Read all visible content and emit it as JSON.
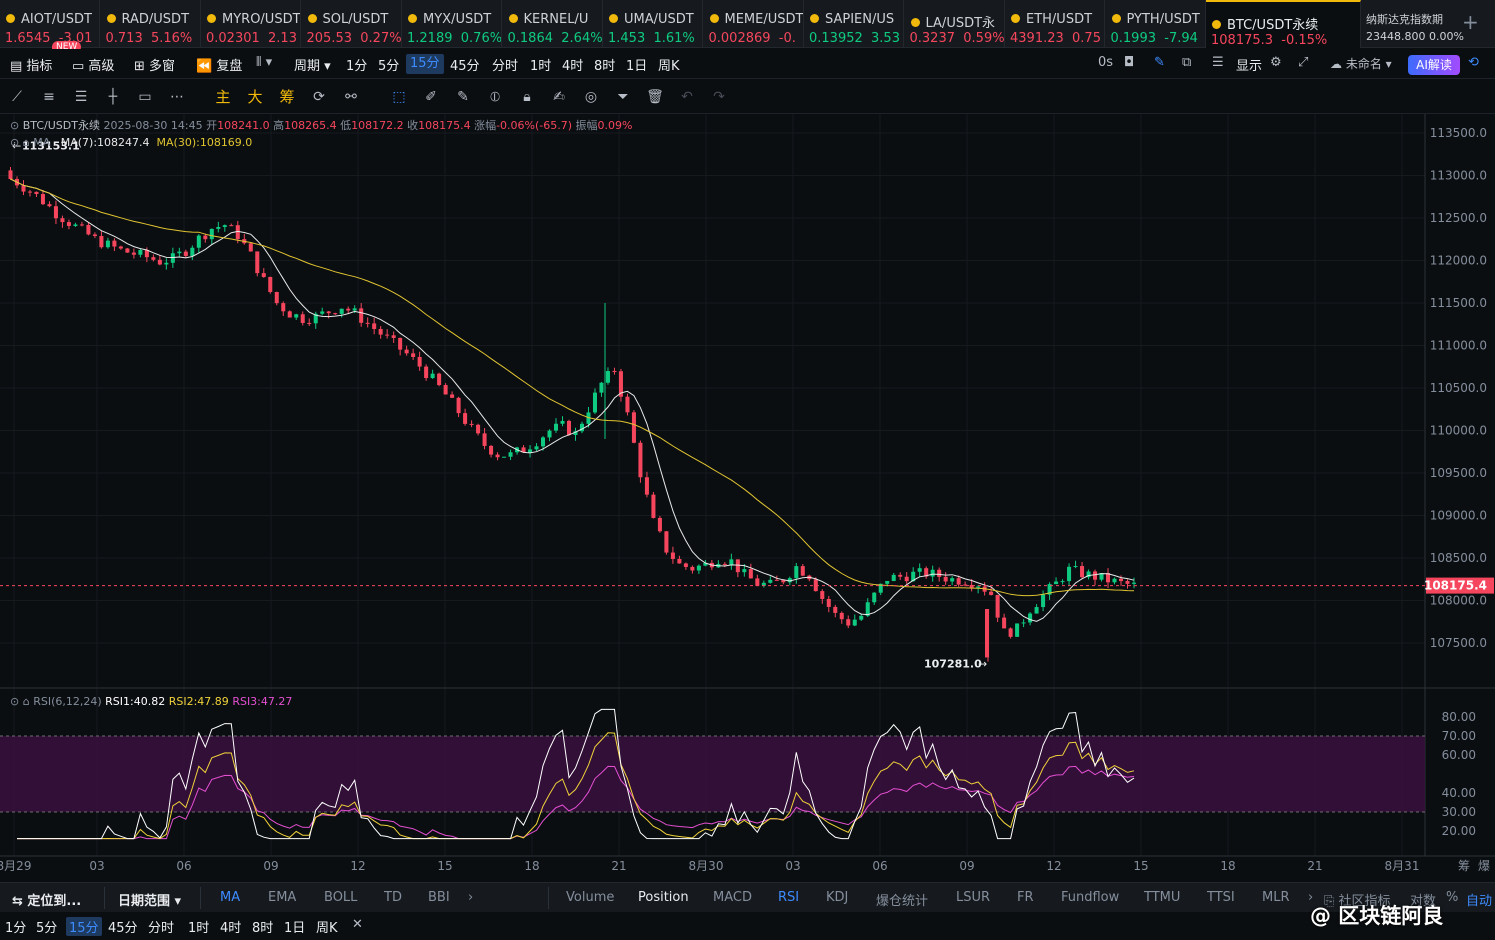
{
  "tickers": [
    {
      "symbol": "AIOT/USDT",
      "price": "1.6545",
      "change": "-3.01",
      "up": false
    },
    {
      "symbol": "RAD/USDT",
      "price": "0.713",
      "change": "5.16%",
      "up": false
    },
    {
      "symbol": "MYRO/USDT",
      "price": "0.02301",
      "change": "2.13",
      "up": false
    },
    {
      "symbol": "SOL/USDT",
      "price": "205.53",
      "change": "0.27%",
      "up": false
    },
    {
      "symbol": "MYX/USDT",
      "price": "1.2189",
      "change": "0.76%",
      "up": true
    },
    {
      "symbol": "KERNEL/U",
      "price": "0.1864",
      "change": "2.64%",
      "up": true
    },
    {
      "symbol": "UMA/USDT",
      "price": "1.453",
      "change": "1.61%",
      "up": true
    },
    {
      "symbol": "MEME/USDT",
      "price": "0.002869",
      "change": "-0.",
      "up": false
    },
    {
      "symbol": "SAPIEN/US",
      "price": "0.13952",
      "change": "3.53",
      "up": true
    },
    {
      "symbol": "LA/USDT永",
      "price": "0.3237",
      "change": "0.59%",
      "up": false
    },
    {
      "symbol": "ETH/USDT",
      "price": "4391.23",
      "change": "0.75",
      "up": false
    },
    {
      "symbol": "PYTH/USDT",
      "price": "0.1993",
      "change": "-7.94",
      "up": true
    },
    {
      "symbol": "BTC/USDT永续",
      "price": "108175.3",
      "change": "-0.15%",
      "up": false,
      "active": true
    }
  ],
  "new_badge": "NEW",
  "nasdaq": {
    "title": "纳斯达克指数期",
    "value": "23448.800",
    "change": "0.00%"
  },
  "toolbar": {
    "indicator": "指标",
    "advanced": "高级",
    "multi_window": "多窗",
    "replay": "复盘",
    "period": "周期",
    "intervals": [
      "1分",
      "5分",
      "15分",
      "45分",
      "分时",
      "1时",
      "4时",
      "8时",
      "1日",
      "周K"
    ],
    "selected_interval": "15分",
    "countdown": "0s",
    "display": "显示",
    "unnamed": "未命名",
    "ai": "AI解读"
  },
  "tools_gold": [
    "主",
    "大",
    "筹"
  ],
  "info": {
    "pair": "BTC/USDT永续",
    "datetime": "2025-08-30 14:45",
    "open_label": "开",
    "open": "108241.0",
    "high_label": "高",
    "high": "108265.4",
    "low_label": "低",
    "low": "108172.2",
    "close_label": "收",
    "close": "108175.4",
    "change_label": "涨幅",
    "change": "-0.06%(-65.7)",
    "amp_label": "振幅",
    "amp": "0.09%"
  },
  "ma_legend": {
    "label": "MA",
    "ma7": "MA(7):108247.4",
    "ma30": "MA(30):108169.0"
  },
  "rsi_legend": {
    "label": "RSI(6,12,24)",
    "rsi1": "RSI1:40.82",
    "rsi2": "RSI2:47.89",
    "rsi3": "RSI3:47.27"
  },
  "colors": {
    "up": "#0ecb81",
    "down": "#f6465d",
    "ma7": "#e8e8e8",
    "ma30": "#e0c431",
    "rsi1": "#ffffff",
    "rsi2": "#f0d23a",
    "rsi3": "#e34fd1",
    "rsi_band": "#3a0f3e"
  },
  "chart_data": {
    "type": "candlestick",
    "symbol": "BTC/USDT永续",
    "interval": "15分",
    "price_axis": [
      "113500.0",
      "113000.0",
      "112500.0",
      "112000.0",
      "111500.0",
      "111000.0",
      "110500.0",
      "110000.0",
      "109500.0",
      "109000.0",
      "108500.0",
      "108000.0",
      "107500.0"
    ],
    "ylim": [
      107000,
      113800
    ],
    "current_price": "108175.4",
    "high_marker": "113153.1",
    "low_marker": "107281.0",
    "x_labels": [
      "8月29",
      "03",
      "06",
      "09",
      "12",
      "15",
      "18",
      "21",
      "8月30",
      "03",
      "06",
      "09",
      "12",
      "15",
      "18",
      "21",
      "8月31"
    ],
    "rsi_axis": [
      "80.00",
      "70.00",
      "60.00",
      "40.00",
      "30.00",
      "20.00"
    ],
    "rsi_band": [
      30,
      70
    ],
    "rsi_ylim": [
      15,
      85
    ],
    "close_series": [
      113000,
      112920,
      112820,
      112700,
      112560,
      112450,
      112350,
      112250,
      112180,
      112120,
      112080,
      112040,
      111990,
      112020,
      112120,
      112260,
      112380,
      112420,
      112300,
      112060,
      111760,
      111500,
      111380,
      111320,
      111340,
      111400,
      111460,
      111380,
      111260,
      111140,
      111020,
      110900,
      110760,
      110600,
      110420,
      110220,
      110010,
      109830,
      109720,
      109710,
      109780,
      109880,
      110000,
      110050,
      109960,
      110260,
      110550,
      110720,
      110180,
      109500,
      108920,
      108600,
      108420,
      108380,
      108420,
      108500,
      108460,
      108300,
      108200,
      108180,
      108250,
      108400,
      108300,
      108030,
      107830,
      107740,
      107820,
      108060,
      108260,
      108280,
      108310,
      108320,
      108290,
      108250,
      108240,
      108200,
      108080,
      107620,
      107660,
      107900,
      108060,
      108200,
      108360,
      108320,
      108280,
      108240,
      108200,
      108175
    ]
  },
  "bottom": {
    "locate": "定位到...",
    "date_range": "日期范围",
    "indicators_main": [
      "MA",
      "EMA",
      "BOLL",
      "TD",
      "BBI"
    ],
    "indicators_sub": [
      "Volume",
      "Position",
      "MACD",
      "RSI",
      "KDJ",
      "爆仓统计",
      "LSUR",
      "FR",
      "Fundflow",
      "TTMU",
      "TTSI",
      "MLR"
    ],
    "community": "社区指标",
    "log": "对数",
    "pct": "%",
    "auto": "自动",
    "intervals": [
      "1分",
      "5分",
      "15分",
      "45分",
      "分时",
      "1时",
      "4时",
      "8时",
      "1日",
      "周K"
    ],
    "selected_interval": "15分"
  },
  "right_labels": {
    "chip": "筹",
    "liq": "爆"
  },
  "watermark": "@ 区块链阿良"
}
